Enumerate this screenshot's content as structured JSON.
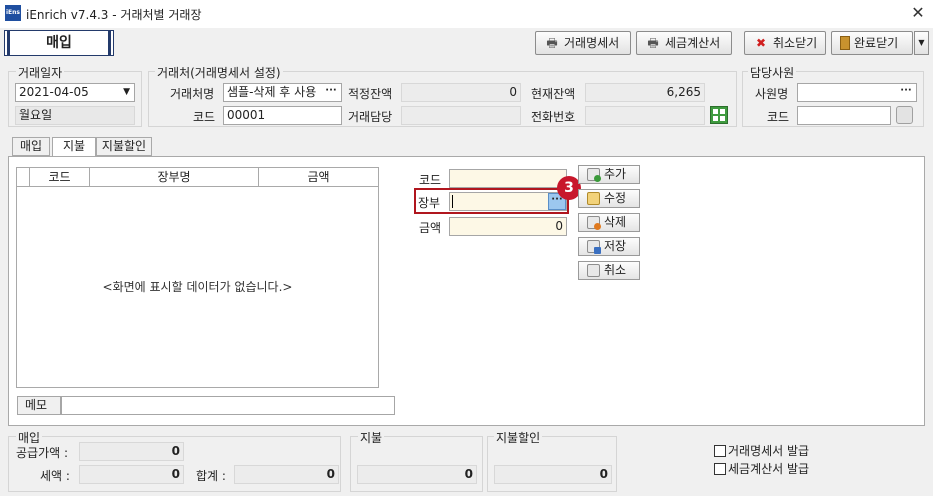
{
  "window": {
    "logo_text": "iEns",
    "title": "iEnrich v7.4.3 - 거래처별 거래장"
  },
  "mode_label": "매입",
  "toolbar": {
    "invoice_label": "거래명세서",
    "tax_invoice_label": "세금계산서",
    "cancel_close_label": "취소닫기",
    "done_close_label": "완료닫기"
  },
  "trade_date": {
    "title": "거래일자",
    "date_value": "2021-04-05",
    "weekday": "월요일"
  },
  "partner": {
    "title": "거래처(거래명세서 설정)",
    "name_label": "거래처명",
    "name_value": "샘플-삭제 후 사용",
    "code_label": "코드",
    "code_value": "00001",
    "initial_balance_label": "적정잔액",
    "initial_balance_value": "0",
    "current_balance_label": "현재잔액",
    "current_balance_value": "6,265",
    "contact_label": "거래담당",
    "contact_value": "",
    "phone_label": "전화번호",
    "phone_value": ""
  },
  "staff": {
    "title": "담당사원",
    "name_label": "사원명",
    "name_value": "",
    "code_label": "코드",
    "code_value": ""
  },
  "tabs": [
    {
      "label": "매입"
    },
    {
      "label": "지불"
    },
    {
      "label": "지불할인"
    }
  ],
  "grid": {
    "columns": [
      "코드",
      "장부명",
      "금액"
    ],
    "empty_message": "<화면에 표시할 데이터가 없습니다.>"
  },
  "memo": {
    "label": "메모",
    "value": ""
  },
  "form": {
    "code_label": "코드",
    "code_value": "",
    "ledger_label": "장부",
    "ledger_value": "",
    "amount_label": "금액",
    "amount_value": "0"
  },
  "actions": {
    "add": "추가",
    "edit": "수정",
    "delete": "삭제",
    "save": "저장",
    "cancel": "취소"
  },
  "step_badge": "3",
  "summary": {
    "purchase_title": "매입",
    "supply_label": "공급가액 :",
    "supply_value": "0",
    "tax_label": "세액 :",
    "tax_value": "0",
    "total_label": "합계 :",
    "total_value": "0",
    "payment_title": "지불",
    "payment_value": "0",
    "discount_title": "지불할인",
    "discount_value": "0"
  },
  "issue": {
    "invoice_label": "거래명세서 발급",
    "tax_invoice_label": "세금계산서 발급"
  }
}
